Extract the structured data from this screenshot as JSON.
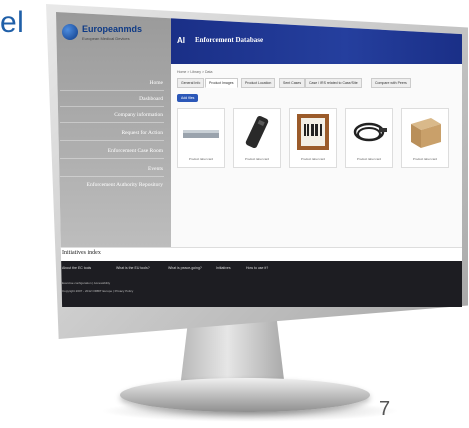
{
  "slide": {
    "title_fragment": "el",
    "page_number": "7"
  },
  "app": {
    "logo_text": "Europeanmds",
    "logo_sub": "European Medical Devices",
    "sidebar_items": [
      "Home",
      "Dashboard",
      "Company information",
      "Request for Action",
      "Enforcement Case Room",
      "Events",
      "Enforcement Authority Repository"
    ],
    "header_title": "Enforcement Database",
    "header_tag": "",
    "header_user": "",
    "breadcrumb": "Home > Library > Data",
    "tabs": [
      "General Info",
      "Product Images",
      "Product Location",
      "Sent Cases",
      "Case / IRS related to Case/Site",
      "Compare with Peers"
    ],
    "add_button": "Add files",
    "products": [
      {
        "name": "router",
        "label": "Product label card"
      },
      {
        "name": "remote",
        "label": "Product label card"
      },
      {
        "name": "barcode-frame",
        "label": "Product label card"
      },
      {
        "name": "cable",
        "label": "Product label card"
      },
      {
        "name": "box",
        "label": "Product label card"
      }
    ],
    "footer_title": "Initiatives index",
    "footer_links": [
      "About the EC tools",
      "What is the EU tools?",
      "What is peace-going?",
      "Initiatives",
      "How to use it?"
    ],
    "footer_left_line1": "Exercise configuration | Accessibility",
    "footer_left_line2": "Copyright 2007 - 2012 ORBIT Europe | Privacy Policy"
  }
}
